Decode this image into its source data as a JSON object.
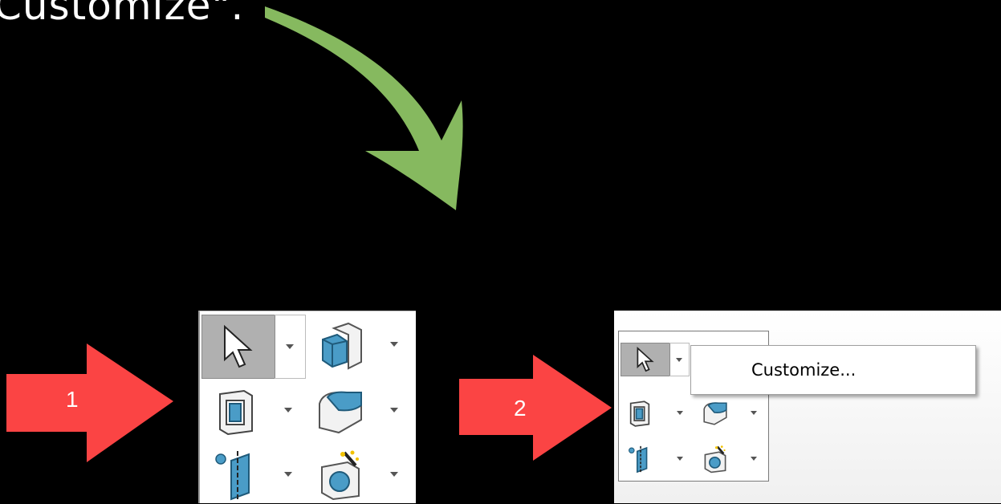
{
  "caption": {
    "text": "Customize\"."
  },
  "callouts": [
    {
      "number": "1",
      "color": "#fb4444"
    },
    {
      "number": "2",
      "color": "#fb4444"
    }
  ],
  "curved_arrow": {
    "color": "#86b95f"
  },
  "toolbar": {
    "buttons": [
      {
        "icon": "select-pointer-icon",
        "selected": true,
        "has_dropdown": true
      },
      {
        "icon": "extruded-boss-icon",
        "selected": false,
        "has_dropdown": true
      },
      {
        "icon": "cut-extrude-icon",
        "selected": false,
        "has_dropdown": true
      },
      {
        "icon": "fillet-icon",
        "selected": false,
        "has_dropdown": true
      },
      {
        "icon": "reference-plane-icon",
        "selected": false,
        "has_dropdown": true
      },
      {
        "icon": "hole-wizard-icon",
        "selected": false,
        "has_dropdown": true
      }
    ]
  },
  "context_menu": {
    "items": [
      {
        "label": "Customize..."
      }
    ]
  },
  "colors": {
    "icon_blue": "#4a9cc7",
    "selected_bg": "#b0b0b0"
  }
}
